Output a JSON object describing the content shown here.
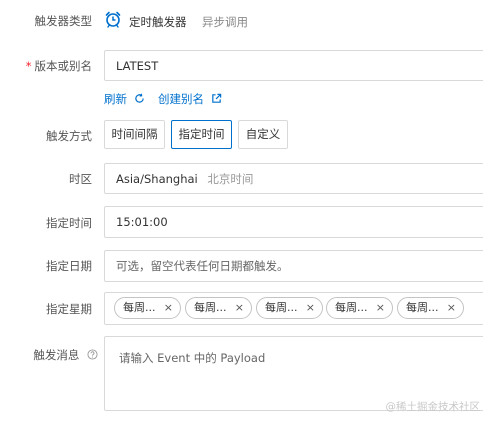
{
  "trigger_type": {
    "label": "触发器类型",
    "selected": "定时触发器",
    "other": "异步调用"
  },
  "version": {
    "label": "版本或别名",
    "value": "LATEST",
    "refresh": "刷新",
    "create_alias": "创建别名"
  },
  "trigger_mode": {
    "label": "触发方式",
    "options": [
      "时间间隔",
      "指定时间",
      "自定义"
    ],
    "selected_index": 1
  },
  "timezone": {
    "label": "时区",
    "value": "Asia/Shanghai",
    "hint": "北京时间"
  },
  "time": {
    "label": "指定时间",
    "value": "15:01:00"
  },
  "date": {
    "label": "指定日期",
    "placeholder": "可选，留空代表任何日期都触发。"
  },
  "weekday": {
    "label": "指定星期",
    "tags": [
      "每周...",
      "每周...",
      "每周...",
      "每周...",
      "每周..."
    ],
    "remove_icon": "×"
  },
  "message": {
    "label": "触发消息",
    "placeholder": "请输入 Event 中的 Payload"
  },
  "watermark": "@稀土掘金技术社区",
  "colors": {
    "accent": "#0070cc",
    "required": "#f5222d",
    "border": "#d9d9d9"
  }
}
